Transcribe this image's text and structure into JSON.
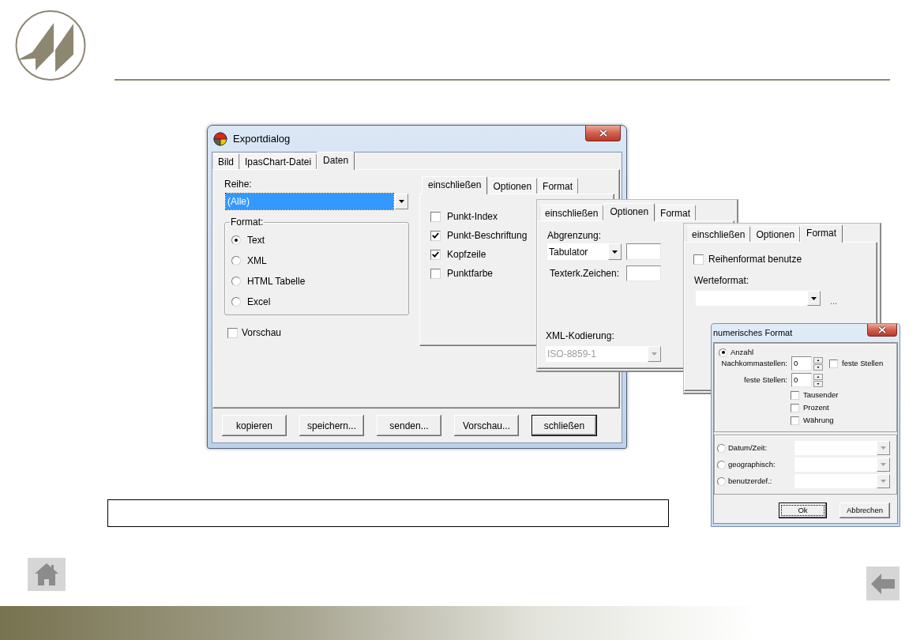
{
  "export_dialog": {
    "title": "Exportdialog",
    "tabs": [
      {
        "label": "Bild",
        "selected": false
      },
      {
        "label": "IpasChart-Datei",
        "selected": false
      },
      {
        "label": "Daten",
        "selected": true
      }
    ],
    "series": {
      "label": "Reihe:",
      "value": "(Alle)",
      "highlighted": true
    },
    "format": {
      "legend": "Format:",
      "options": [
        {
          "label": "Text",
          "selected": true
        },
        {
          "label": "XML",
          "selected": false
        },
        {
          "label": "HTML Tabelle",
          "selected": false
        },
        {
          "label": "Excel",
          "selected": false
        }
      ]
    },
    "preview": {
      "label": "Vorschau",
      "checked": false
    },
    "buttons": [
      {
        "label": "kopieren",
        "default": false
      },
      {
        "label": "speichern...",
        "default": false
      },
      {
        "label": "senden...",
        "default": false
      },
      {
        "label": "Vorschau...",
        "default": false
      },
      {
        "label": "schließen",
        "default": true
      }
    ]
  },
  "include_panel": {
    "tabs": [
      {
        "label": "einschließen",
        "selected": true
      },
      {
        "label": "Optionen",
        "selected": false
      },
      {
        "label": "Format",
        "selected": false
      }
    ],
    "checkboxes": [
      {
        "label": "Punkt-Index",
        "checked": false
      },
      {
        "label": "Punkt-Beschriftung",
        "checked": true
      },
      {
        "label": "Kopfzeile",
        "checked": true
      },
      {
        "label": "Punktfarbe",
        "checked": false
      }
    ]
  },
  "options_panel": {
    "tabs": [
      {
        "label": "einschließen",
        "selected": false
      },
      {
        "label": "Optionen",
        "selected": true
      },
      {
        "label": "Format",
        "selected": false
      }
    ],
    "delimiter": {
      "label": "Abgrenzung:",
      "value": "Tabulator"
    },
    "text_qualifier": {
      "label": "Texterk.Zeichen:"
    },
    "xml_encoding": {
      "label": "XML-Kodierung:",
      "value": "ISO-8859-1",
      "disabled": true
    }
  },
  "format_panel": {
    "tabs": [
      {
        "label": "einschließen",
        "selected": false
      },
      {
        "label": "Optionen",
        "selected": false
      },
      {
        "label": "Format",
        "selected": true
      }
    ],
    "series_format": {
      "label": "Reihenformat benutze",
      "checked": false
    },
    "value_format": {
      "label": "Werteformat:"
    },
    "more_button": "..."
  },
  "numeric_format_dialog": {
    "title": "numerisches Format",
    "categories": [
      {
        "kind": "number",
        "label": "Anzahl",
        "selected": true
      },
      {
        "kind": "select",
        "label": "Datum/Zeit:",
        "selected": false
      },
      {
        "kind": "select",
        "label": "geographisch:",
        "selected": false
      },
      {
        "kind": "select",
        "label": "benutzerdef.:",
        "selected": false
      }
    ],
    "decimals": {
      "label": "Nachkommastellen:",
      "value": "0"
    },
    "fixed_digits_checkbox": {
      "label": "feste Stellen",
      "checked": false
    },
    "fixed_digits": {
      "label": "feste Stellen:",
      "value": "0"
    },
    "flags": [
      {
        "label": "Tausender",
        "checked": false
      },
      {
        "label": "Prozent",
        "checked": false
      },
      {
        "label": "Währung",
        "checked": false
      }
    ],
    "buttons": [
      {
        "label": "Ok",
        "focused": true
      },
      {
        "label": "Abbrechen",
        "focused": false
      }
    ]
  }
}
